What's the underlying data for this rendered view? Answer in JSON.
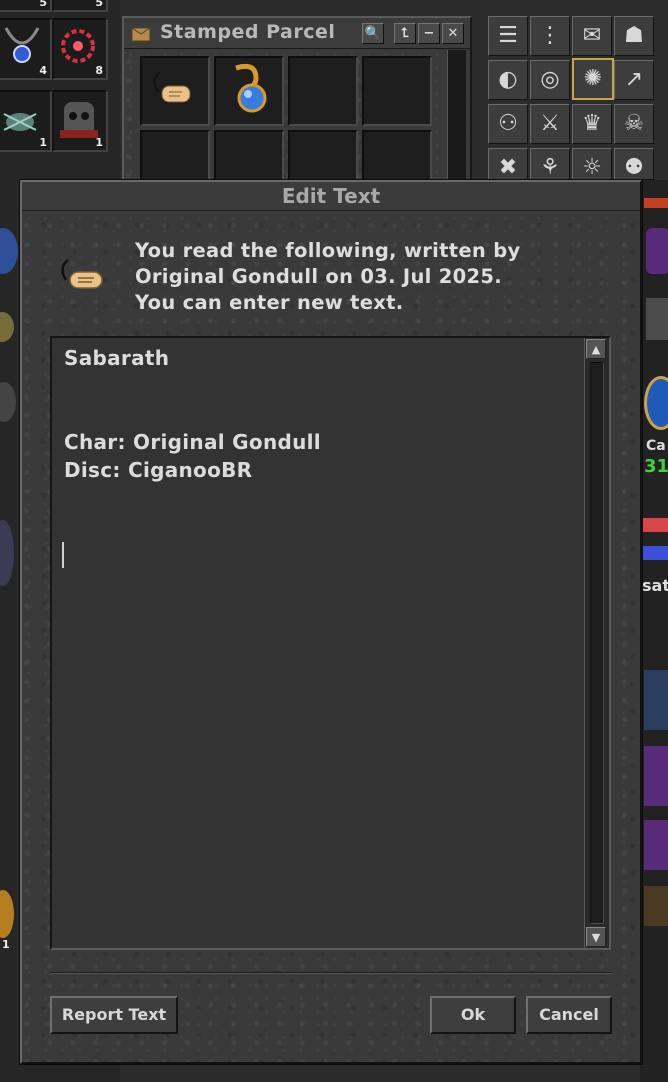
{
  "background": {
    "left_slots": [
      {
        "quantity": "4"
      },
      {
        "quantity": "8"
      },
      {
        "quantity": "1"
      },
      {
        "quantity": "1"
      }
    ],
    "left_numbers": [
      "5",
      "5",
      "1"
    ],
    "right_fragments": {
      "ca": "Ca",
      "num": "31",
      "sat": "sat"
    },
    "parcel_window": {
      "title": "Stamped Parcel",
      "buttons": {
        "search": "🔍",
        "up": "⮤",
        "minimize": "−",
        "close": "✕"
      }
    }
  },
  "dialog": {
    "title": "Edit Text",
    "info_lines": [
      "You read the following, written by",
      "Original Gondull on 03. Jul 2025.",
      "You can enter new text."
    ],
    "editor_text": "Sabarath\n\n\nChar: Original Gondull\nDisc: CiganooBR",
    "buttons": {
      "report": "Report Text",
      "ok": "Ok",
      "cancel": "Cancel"
    }
  },
  "colors": {
    "stone": "#3a3a3a",
    "text": "#dcdcdc",
    "title_text": "#a9a9a9",
    "highlight_border": "#c9a54a",
    "green_number": "#3fd23f"
  }
}
